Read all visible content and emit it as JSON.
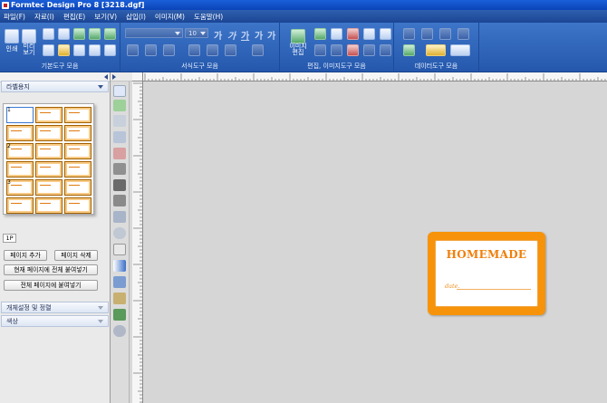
{
  "app": {
    "title": "Formtec Design Pro 8 [3218.dgf]"
  },
  "menu": [
    "파일(F)",
    "자료(I)",
    "편집(E)",
    "보기(V)",
    "삽입(I)",
    "이미지(M)",
    "도움말(H)"
  ],
  "toolbar": {
    "groups": [
      {
        "label": "기본도구 모음"
      },
      {
        "label": "서식도구 모음"
      },
      {
        "label": "편집, 이미지도구 모음"
      },
      {
        "label": "데이터도구 모음"
      }
    ],
    "print_label": "인쇄",
    "preview_label": "미리\n보기",
    "image_edit_label": "이미지\n편집",
    "font_size": "10",
    "font_name": "",
    "format_glyphs": [
      "가",
      "가",
      "가",
      "가",
      "가"
    ]
  },
  "left_panel": {
    "section_title": "라벨용지",
    "page_tab": "1P",
    "page_number_marks": [
      "1",
      "2",
      "3"
    ],
    "buttons": {
      "add_page": "페이지 추가",
      "delete_page": "페이지 삭제",
      "paste_all_current": "현재 페이지에 전체 붙여넣기",
      "paste_all_pages": "전체 페이지에 붙여넣기"
    },
    "sections": [
      "개체설정 및 정렬",
      "색상"
    ]
  },
  "label": {
    "title": "HOMEMADE",
    "date_text": "date."
  },
  "colors": {
    "label_orange": "#f7930b",
    "toolbar_blue": "#2f67bd",
    "title_blue": "#0b43b8"
  }
}
